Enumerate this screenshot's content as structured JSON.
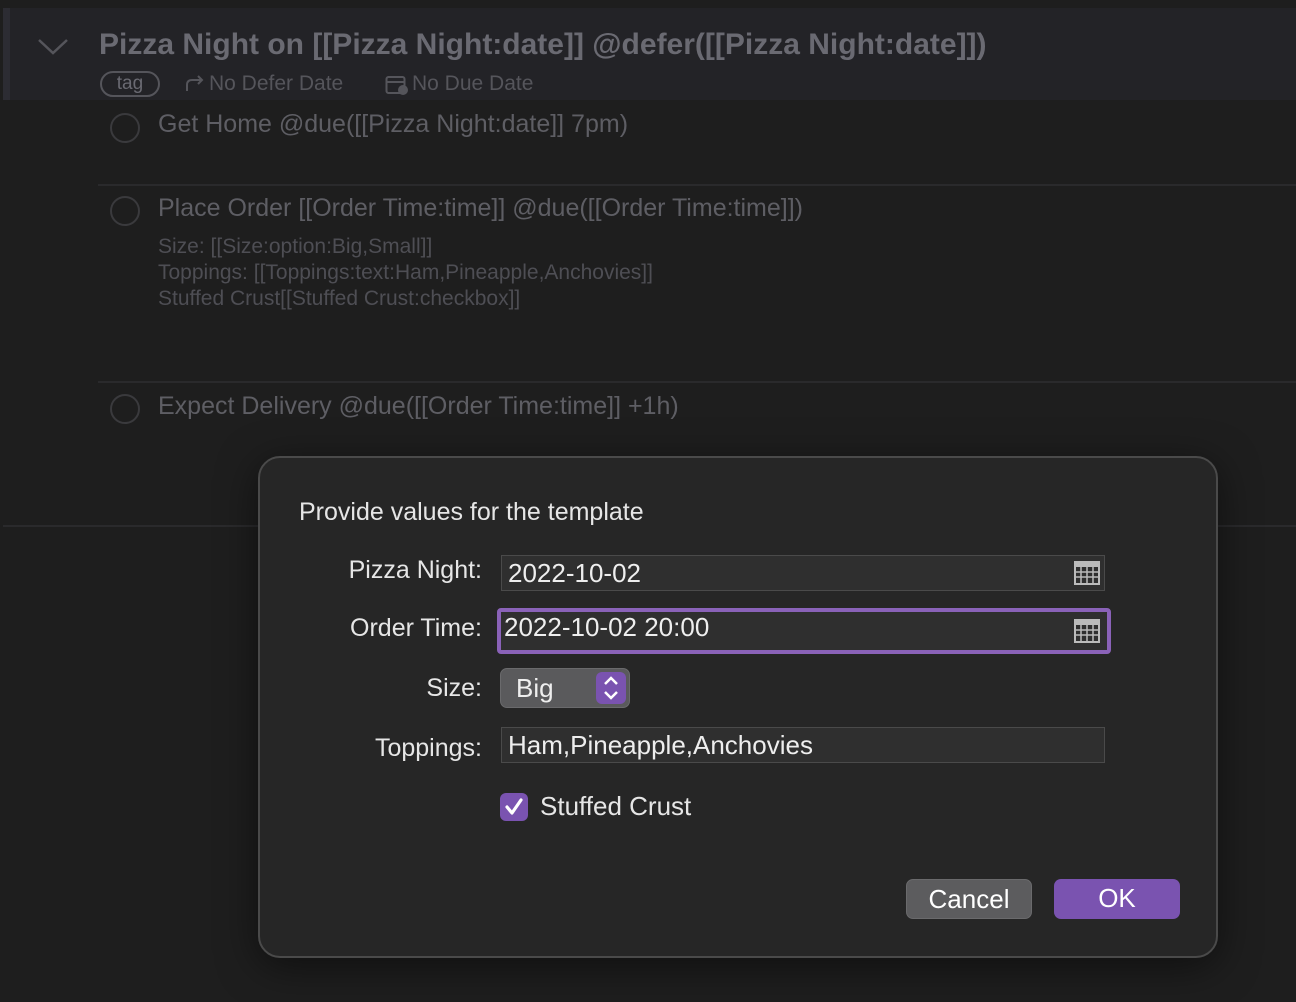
{
  "project": {
    "title": "Pizza Night on [[Pizza Night:date]] @defer([[Pizza Night:date]])",
    "tag": "tag",
    "defer_label": "No Defer Date",
    "due_label": "No Due Date"
  },
  "tasks": [
    {
      "title": "Get Home @due([[Pizza Night:date]] 7pm)",
      "note_lines": []
    },
    {
      "title": "Place Order [[Order Time:time]] @due([[Order Time:time]])",
      "note_lines": [
        "Size: [[Size:option:Big,Small]]",
        "Toppings: [[Toppings:text:Ham,Pineapple,Anchovies]]",
        "Stuffed Crust[[Stuffed Crust:checkbox]]"
      ]
    },
    {
      "title": "Expect Delivery @due([[Order Time:time]] +1h)",
      "note_lines": []
    }
  ],
  "dialog": {
    "title": "Provide values for the template",
    "fields": {
      "pizza_night": {
        "label": "Pizza Night:",
        "value": "2022-10-02"
      },
      "order_time": {
        "label": "Order Time:",
        "value": "2022-10-02 20:00"
      },
      "size": {
        "label": "Size:",
        "value": "Big"
      },
      "toppings": {
        "label": "Toppings:",
        "value": "Ham,Pineapple,Anchovies"
      },
      "stuffed_crust": {
        "label": "Stuffed Crust",
        "checked": true
      }
    },
    "cancel_label": "Cancel",
    "ok_label": "OK",
    "accent_color": "#7a53b0"
  },
  "icons": {
    "disclosure": "chevron-down-icon",
    "defer": "defer-arrow-icon",
    "due": "calendar-due-icon",
    "date_picker": "calendar-icon",
    "select": "up-down-chevron-icon",
    "check": "checkmark-icon"
  }
}
